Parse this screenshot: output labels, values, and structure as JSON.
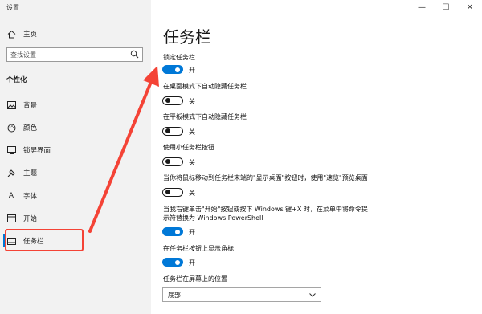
{
  "window": {
    "title": "设置"
  },
  "window_controls": {
    "minimize": "—",
    "maximize": "☐",
    "close": "✕"
  },
  "sidebar": {
    "home": "主页",
    "search_placeholder": "查找设置",
    "section": "个性化",
    "items": [
      {
        "label": "背景",
        "icon": "image-icon"
      },
      {
        "label": "颜色",
        "icon": "palette-icon"
      },
      {
        "label": "锁屏界面",
        "icon": "lock-screen-icon"
      },
      {
        "label": "主题",
        "icon": "theme-icon"
      },
      {
        "label": "字体",
        "icon": "font-icon"
      },
      {
        "label": "开始",
        "icon": "start-icon"
      },
      {
        "label": "任务栏",
        "icon": "taskbar-icon",
        "selected": true
      }
    ]
  },
  "main": {
    "title": "任务栏",
    "settings": [
      {
        "label": "锁定任务栏",
        "state": "开",
        "on": true
      },
      {
        "label": "在桌面模式下自动隐藏任务栏",
        "state": "关",
        "on": false
      },
      {
        "label": "在平板模式下自动隐藏任务栏",
        "state": "关",
        "on": false
      },
      {
        "label": "使用小任务栏按钮",
        "state": "关",
        "on": false
      },
      {
        "label": "当你将鼠标移动到任务栏末端的\"显示桌面\"按钮时，使用\"速览\"预览桌面",
        "state": "关",
        "on": false
      },
      {
        "label_line1": "当我右键单击\"开始\"按钮或按下 Windows 键+X 时，在菜单中将命令提",
        "label_line2": "示符替换为 Windows PowerShell",
        "state": "开",
        "on": true
      },
      {
        "label": "在任务栏按钮上显示角标",
        "state": "开",
        "on": true
      }
    ],
    "position": {
      "label": "任务栏在屏幕上的位置",
      "value": "底部"
    }
  },
  "colors": {
    "accent": "#0078d7",
    "annotation": "#f44336"
  }
}
